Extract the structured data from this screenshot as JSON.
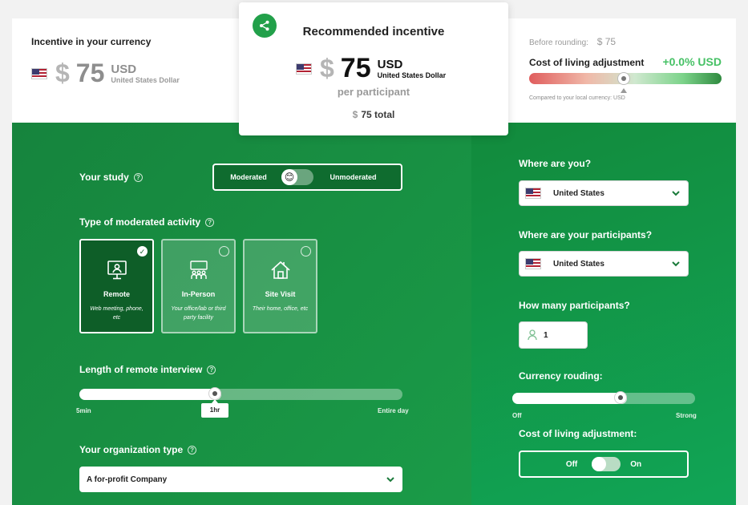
{
  "local_currency": {
    "label": "Incentive in your currency",
    "symbol": "$",
    "amount": "75",
    "code": "USD",
    "name": "United States Dollar"
  },
  "recommended": {
    "title": "Recommended incentive",
    "symbol": "$",
    "amount": "75",
    "code": "USD",
    "name": "United States Dollar",
    "per_participant": "per participant",
    "total_symbol": "$",
    "total_amount": "75",
    "total_label": "total"
  },
  "rounding_info": {
    "before_label": "Before rounding:",
    "before_value": "$ 75",
    "cola_label": "Cost of living adjustment",
    "cola_value": "+0.0% USD",
    "compare_note": "Compared to your local currency: USD"
  },
  "study": {
    "label": "Your study",
    "help": "?",
    "moderated_label": "Moderated",
    "unmoderated_label": "Unmoderated",
    "toggle_emoji": "😊"
  },
  "activity": {
    "label": "Type of moderated activity",
    "help": "?",
    "options": [
      {
        "title": "Remote",
        "desc": "Web meeting, phone, etc",
        "selected": true
      },
      {
        "title": "In-Person",
        "desc": "Your office/lab or third party facility",
        "selected": false
      },
      {
        "title": "Site Visit",
        "desc": "Their home, office, etc",
        "selected": false
      }
    ],
    "check_mark": "✓"
  },
  "interview_length": {
    "label": "Length of remote interview",
    "help": "?",
    "min_label": "5min",
    "max_label": "Entire day",
    "current_label": "1hr",
    "position": 0.42
  },
  "organization": {
    "label": "Your organization type",
    "help": "?",
    "value": "A for-profit Company"
  },
  "location": {
    "label": "Where are you?",
    "value": "United States"
  },
  "participants_location": {
    "label": "Where are your participants?",
    "value": "United States"
  },
  "participants_count": {
    "label": "How many participants?",
    "value": "1"
  },
  "currency_rounding": {
    "label": "Currency rouding:",
    "min_label": "Off",
    "max_label": "Strong",
    "position": 0.59
  },
  "cola_toggle": {
    "label": "Cost of living adjustment:",
    "off_label": "Off",
    "on_label": "On"
  },
  "colors": {
    "brand_green": "#22a04a",
    "positive_green": "#46c165"
  }
}
